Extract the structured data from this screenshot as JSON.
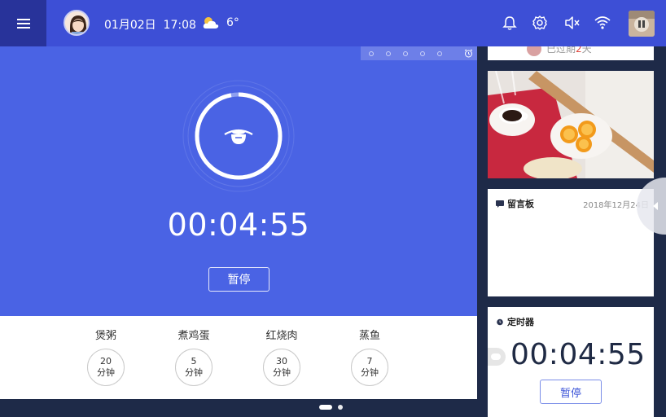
{
  "header": {
    "date": "01月02日",
    "time": "17:08",
    "temperature": "6°",
    "icons": [
      "menu-icon",
      "avatar",
      "cloud-sun-icon",
      "bell-icon",
      "gear-icon",
      "volume-mute-icon",
      "wifi-icon",
      "profile-thumbnail"
    ]
  },
  "timer": {
    "display": "00:04:55",
    "pause_label": "暂停",
    "ring_progress": 0.97
  },
  "presets": [
    {
      "name": "煲粥",
      "minutes": "20",
      "unit": "分钟"
    },
    {
      "name": "煮鸡蛋",
      "minutes": "5",
      "unit": "分钟"
    },
    {
      "name": "红烧肉",
      "minutes": "30",
      "unit": "分钟"
    },
    {
      "name": "蒸鱼",
      "minutes": "7",
      "unit": "分钟"
    }
  ],
  "pager": {
    "pages": 2,
    "active": 0
  },
  "sidebar": {
    "top_card_text": "已过期",
    "top_card_highlight": "2",
    "top_card_suffix": "天",
    "message_board": {
      "title": "留言板",
      "date": "2018年12月24日"
    },
    "timer_card": {
      "title": "定时器",
      "display": "00:04:55",
      "pause_label": "暂停"
    }
  },
  "colors": {
    "topbar": "#3d4fd6",
    "menu": "#28339a",
    "panel": "#4a63e4",
    "background": "#1e2a48",
    "accent": "#3d55d8"
  }
}
